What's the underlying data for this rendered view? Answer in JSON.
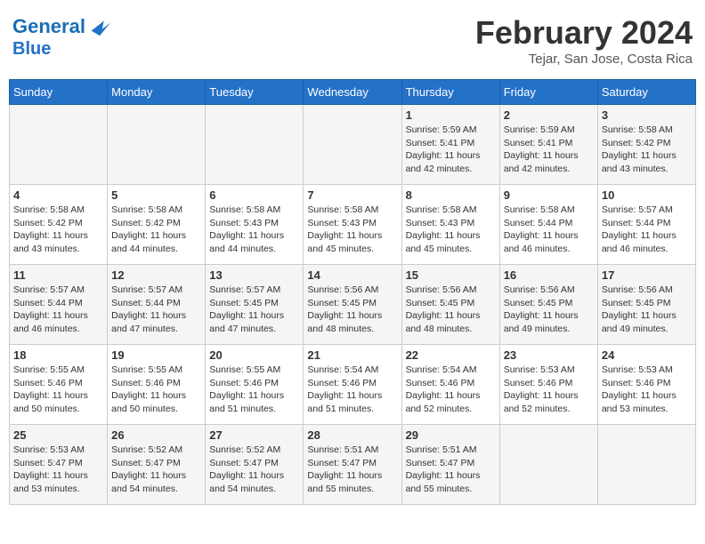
{
  "header": {
    "logo_line1": "General",
    "logo_line2": "Blue",
    "title": "February 2024",
    "subtitle": "Tejar, San Jose, Costa Rica"
  },
  "days_of_week": [
    "Sunday",
    "Monday",
    "Tuesday",
    "Wednesday",
    "Thursday",
    "Friday",
    "Saturday"
  ],
  "weeks": [
    [
      {
        "day": "",
        "info": ""
      },
      {
        "day": "",
        "info": ""
      },
      {
        "day": "",
        "info": ""
      },
      {
        "day": "",
        "info": ""
      },
      {
        "day": "1",
        "info": "Sunrise: 5:59 AM\nSunset: 5:41 PM\nDaylight: 11 hours\nand 42 minutes."
      },
      {
        "day": "2",
        "info": "Sunrise: 5:59 AM\nSunset: 5:41 PM\nDaylight: 11 hours\nand 42 minutes."
      },
      {
        "day": "3",
        "info": "Sunrise: 5:58 AM\nSunset: 5:42 PM\nDaylight: 11 hours\nand 43 minutes."
      }
    ],
    [
      {
        "day": "4",
        "info": "Sunrise: 5:58 AM\nSunset: 5:42 PM\nDaylight: 11 hours\nand 43 minutes."
      },
      {
        "day": "5",
        "info": "Sunrise: 5:58 AM\nSunset: 5:42 PM\nDaylight: 11 hours\nand 44 minutes."
      },
      {
        "day": "6",
        "info": "Sunrise: 5:58 AM\nSunset: 5:43 PM\nDaylight: 11 hours\nand 44 minutes."
      },
      {
        "day": "7",
        "info": "Sunrise: 5:58 AM\nSunset: 5:43 PM\nDaylight: 11 hours\nand 45 minutes."
      },
      {
        "day": "8",
        "info": "Sunrise: 5:58 AM\nSunset: 5:43 PM\nDaylight: 11 hours\nand 45 minutes."
      },
      {
        "day": "9",
        "info": "Sunrise: 5:58 AM\nSunset: 5:44 PM\nDaylight: 11 hours\nand 46 minutes."
      },
      {
        "day": "10",
        "info": "Sunrise: 5:57 AM\nSunset: 5:44 PM\nDaylight: 11 hours\nand 46 minutes."
      }
    ],
    [
      {
        "day": "11",
        "info": "Sunrise: 5:57 AM\nSunset: 5:44 PM\nDaylight: 11 hours\nand 46 minutes."
      },
      {
        "day": "12",
        "info": "Sunrise: 5:57 AM\nSunset: 5:44 PM\nDaylight: 11 hours\nand 47 minutes."
      },
      {
        "day": "13",
        "info": "Sunrise: 5:57 AM\nSunset: 5:45 PM\nDaylight: 11 hours\nand 47 minutes."
      },
      {
        "day": "14",
        "info": "Sunrise: 5:56 AM\nSunset: 5:45 PM\nDaylight: 11 hours\nand 48 minutes."
      },
      {
        "day": "15",
        "info": "Sunrise: 5:56 AM\nSunset: 5:45 PM\nDaylight: 11 hours\nand 48 minutes."
      },
      {
        "day": "16",
        "info": "Sunrise: 5:56 AM\nSunset: 5:45 PM\nDaylight: 11 hours\nand 49 minutes."
      },
      {
        "day": "17",
        "info": "Sunrise: 5:56 AM\nSunset: 5:45 PM\nDaylight: 11 hours\nand 49 minutes."
      }
    ],
    [
      {
        "day": "18",
        "info": "Sunrise: 5:55 AM\nSunset: 5:46 PM\nDaylight: 11 hours\nand 50 minutes."
      },
      {
        "day": "19",
        "info": "Sunrise: 5:55 AM\nSunset: 5:46 PM\nDaylight: 11 hours\nand 50 minutes."
      },
      {
        "day": "20",
        "info": "Sunrise: 5:55 AM\nSunset: 5:46 PM\nDaylight: 11 hours\nand 51 minutes."
      },
      {
        "day": "21",
        "info": "Sunrise: 5:54 AM\nSunset: 5:46 PM\nDaylight: 11 hours\nand 51 minutes."
      },
      {
        "day": "22",
        "info": "Sunrise: 5:54 AM\nSunset: 5:46 PM\nDaylight: 11 hours\nand 52 minutes."
      },
      {
        "day": "23",
        "info": "Sunrise: 5:53 AM\nSunset: 5:46 PM\nDaylight: 11 hours\nand 52 minutes."
      },
      {
        "day": "24",
        "info": "Sunrise: 5:53 AM\nSunset: 5:46 PM\nDaylight: 11 hours\nand 53 minutes."
      }
    ],
    [
      {
        "day": "25",
        "info": "Sunrise: 5:53 AM\nSunset: 5:47 PM\nDaylight: 11 hours\nand 53 minutes."
      },
      {
        "day": "26",
        "info": "Sunrise: 5:52 AM\nSunset: 5:47 PM\nDaylight: 11 hours\nand 54 minutes."
      },
      {
        "day": "27",
        "info": "Sunrise: 5:52 AM\nSunset: 5:47 PM\nDaylight: 11 hours\nand 54 minutes."
      },
      {
        "day": "28",
        "info": "Sunrise: 5:51 AM\nSunset: 5:47 PM\nDaylight: 11 hours\nand 55 minutes."
      },
      {
        "day": "29",
        "info": "Sunrise: 5:51 AM\nSunset: 5:47 PM\nDaylight: 11 hours\nand 55 minutes."
      },
      {
        "day": "",
        "info": ""
      },
      {
        "day": "",
        "info": ""
      }
    ]
  ]
}
